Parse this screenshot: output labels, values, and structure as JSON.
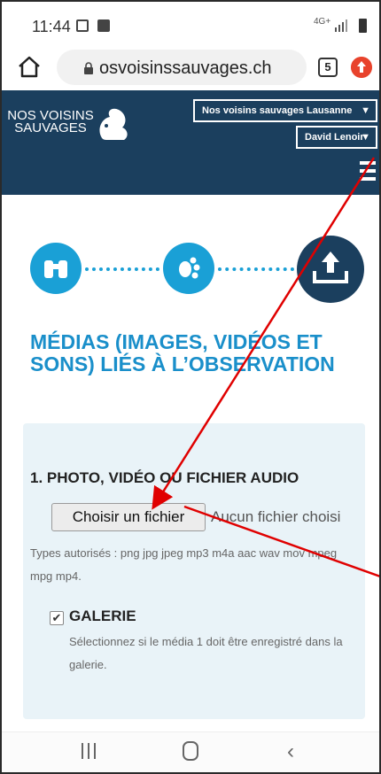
{
  "status_bar": {
    "time": "11:44",
    "network": "4G+"
  },
  "browser": {
    "url": "osvoisinssauvages.ch",
    "tab_count": "5"
  },
  "site_header": {
    "logo_line1": "NOS VOISINS",
    "logo_line2": "SAUVAGES",
    "city_select": "Nos voisins sauvages Lausanne",
    "user_select": "David Lenoir"
  },
  "steps": {
    "icons": [
      "binoculars-icon",
      "paw-icon",
      "upload-icon"
    ],
    "active_step": 3
  },
  "page": {
    "title": "MÉDIAS (IMAGES, VIDÉOS ET SONS) LIÉS À L’OBSERVATION"
  },
  "form": {
    "heading": "1. PHOTO, VIDÉO OU FICHIER AUDIO",
    "file_button": "Choisir un fichier",
    "file_status": "Aucun fichier choisi",
    "types_text": "Types autorisés : png jpg jpeg mp3 m4a aac wav mov mpeg mpg mp4.",
    "galerie_checked": true,
    "galerie_label": "GALERIE",
    "galerie_help": "Sélectionnez si le média 1 doit être enregistré dans la galerie."
  },
  "colors": {
    "header_bg": "#1b3f5e",
    "accent": "#1aa0d6",
    "title": "#1a8fca",
    "card_bg": "#e9f3f8",
    "annotation_arrow": "#e00000"
  }
}
